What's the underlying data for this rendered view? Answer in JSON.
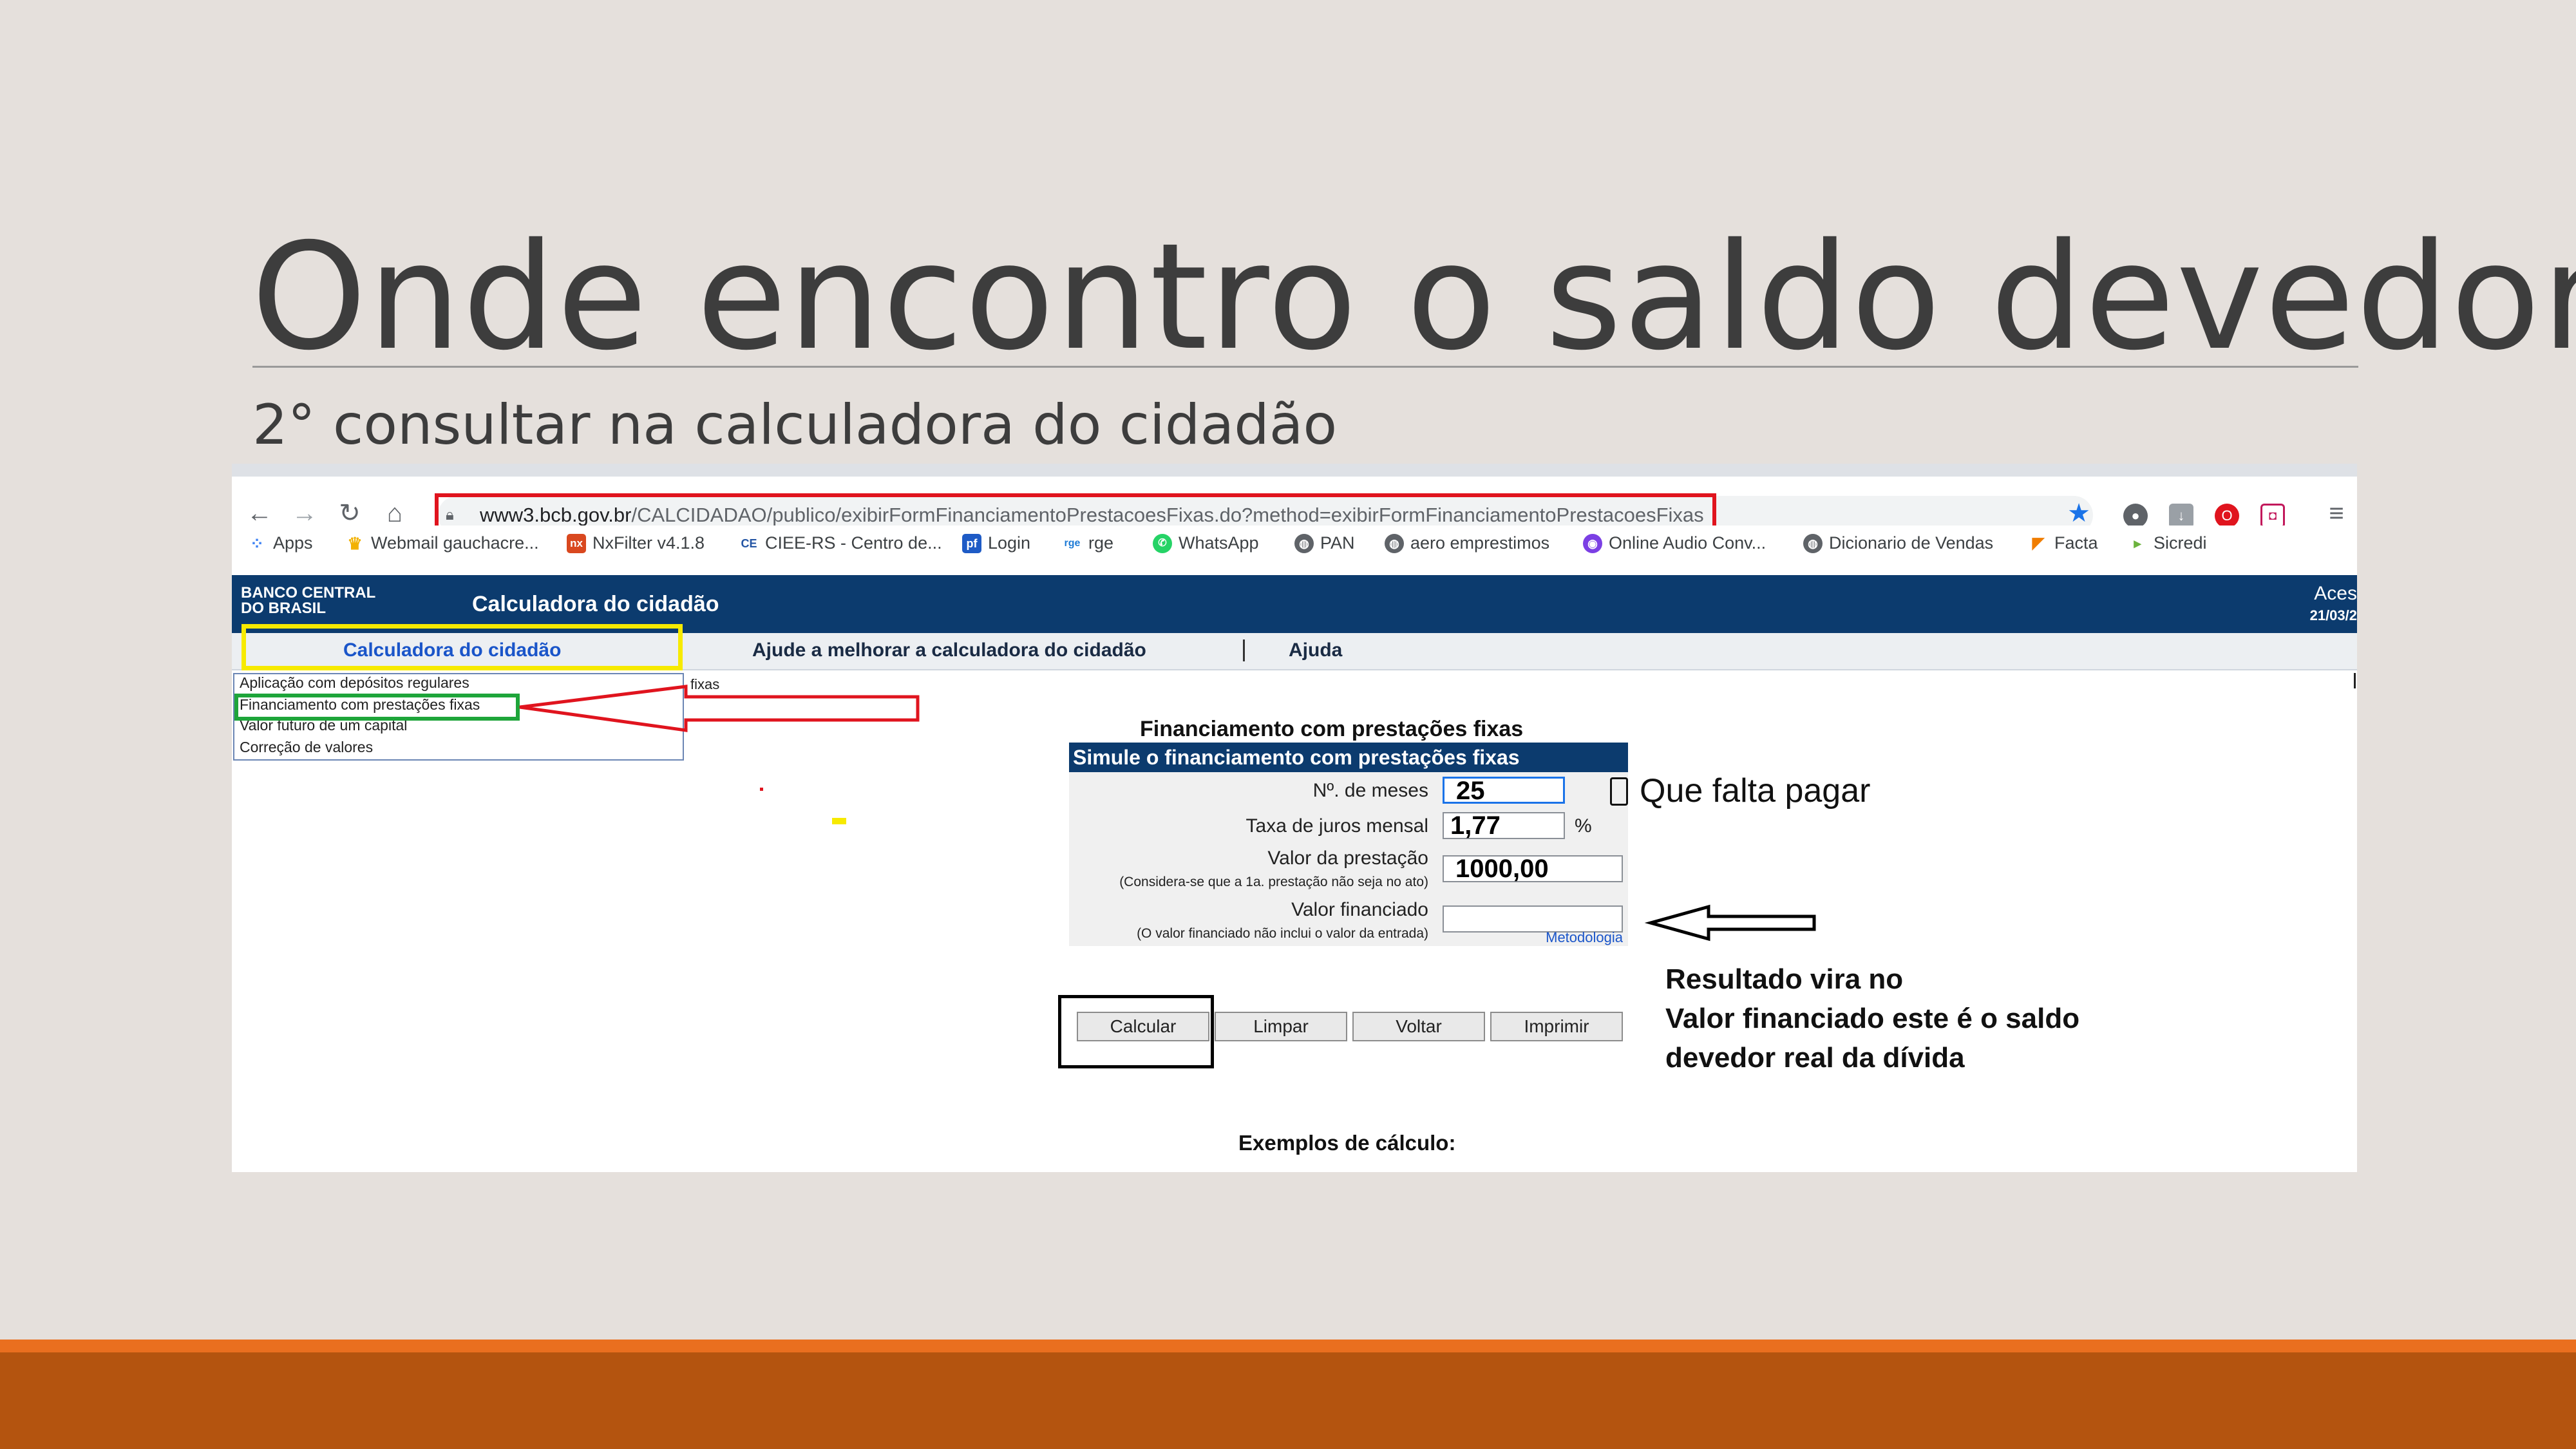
{
  "slide": {
    "title": "Onde encontro o saldo devedor?",
    "subtitle": "2° consultar na calculadora do cidadão"
  },
  "browser": {
    "url_host": "www3.bcb.gov.br",
    "url_path": "/CALCIDADAO/publico/exibirFormFinanciamentoPrestacoesFixas.do?method=exibirFormFinanciamentoPrestacoesFixas",
    "bookmarks": [
      {
        "label": "Apps",
        "icon": "apps-grid-icon",
        "color": "#4285f4"
      },
      {
        "label": "Webmail gauchacre...",
        "icon": "crown-icon",
        "color": "#f2b100"
      },
      {
        "label": "NxFilter v4.1.8",
        "icon": "nx-icon",
        "color": "#d9481f"
      },
      {
        "label": "CIEE-RS - Centro de...",
        "icon": "ciee-icon",
        "color": "#2455a4"
      },
      {
        "label": "Login",
        "icon": "pf-icon",
        "color": "#1e5bc6"
      },
      {
        "label": "rge",
        "icon": "rge-icon",
        "color": "#1e7bd6"
      },
      {
        "label": "WhatsApp",
        "icon": "whatsapp-icon",
        "color": "#25d366"
      },
      {
        "label": "PAN",
        "icon": "globe-icon",
        "color": "#5f6368"
      },
      {
        "label": "aero emprestimos",
        "icon": "globe-icon",
        "color": "#5f6368"
      },
      {
        "label": "Online Audio Conv...",
        "icon": "audio-icon",
        "color": "#7b3fe4"
      },
      {
        "label": "Dicionario de Vendas",
        "icon": "globe-icon",
        "color": "#5f6368"
      },
      {
        "label": "Facta",
        "icon": "facta-icon",
        "color": "#f07d00"
      },
      {
        "label": "Sicredi",
        "icon": "sicredi-icon",
        "color": "#6cb33e"
      }
    ]
  },
  "bcb": {
    "logo_line1": "BANCO CENTRAL",
    "logo_line2": "DO BRASIL",
    "header_title": "Calculadora do cidadão",
    "header_right_1": "Aces",
    "header_right_2": "21/03/2",
    "menu": {
      "item1": "Calculadora do cidadão",
      "item2": "Ajude a melhorar a calculadora do cidadão",
      "item3": "Ajuda"
    },
    "side_menu": [
      "Aplicação com depósitos regulares",
      "Financiamento com prestações fixas",
      "Valor futuro de um capital",
      "Correção de valores"
    ],
    "fixas_fragment": "fixas"
  },
  "form": {
    "title": "Financiamento com prestações fixas",
    "header": "Simule o financiamento com prestações fixas",
    "meses_label": "Nº. de meses",
    "meses_value": "25",
    "juros_label": "Taxa de juros mensal",
    "juros_value": "1,77",
    "juros_unit": "%",
    "prestacao_label": "Valor da prestação",
    "prestacao_note": "(Considera-se que a 1a. prestação não seja no ato)",
    "prestacao_value": "1000,00",
    "financiado_label": "Valor financiado",
    "financiado_note": "(O valor financiado não inclui o valor da entrada)",
    "financiado_value": "",
    "metodologia": "Metodologia",
    "buttons": {
      "calcular": "Calcular",
      "limpar": "Limpar",
      "voltar": "Voltar",
      "imprimir": "Imprimir"
    },
    "examples": "Exemplos de cálculo:"
  },
  "annotations": {
    "falta_pagar": "Que falta pagar",
    "result_line1": "Resultado vira no",
    "result_line2": "Valor financiado este é o saldo",
    "result_line3": "devedor real da dívida"
  },
  "colors": {
    "slide_bg": "#e5e0dc",
    "footer": "#b4540f",
    "bcb_blue": "#0c3b6e",
    "highlight_red": "#e0141e",
    "highlight_yellow": "#f7ea00",
    "highlight_green": "#1ea53a"
  }
}
